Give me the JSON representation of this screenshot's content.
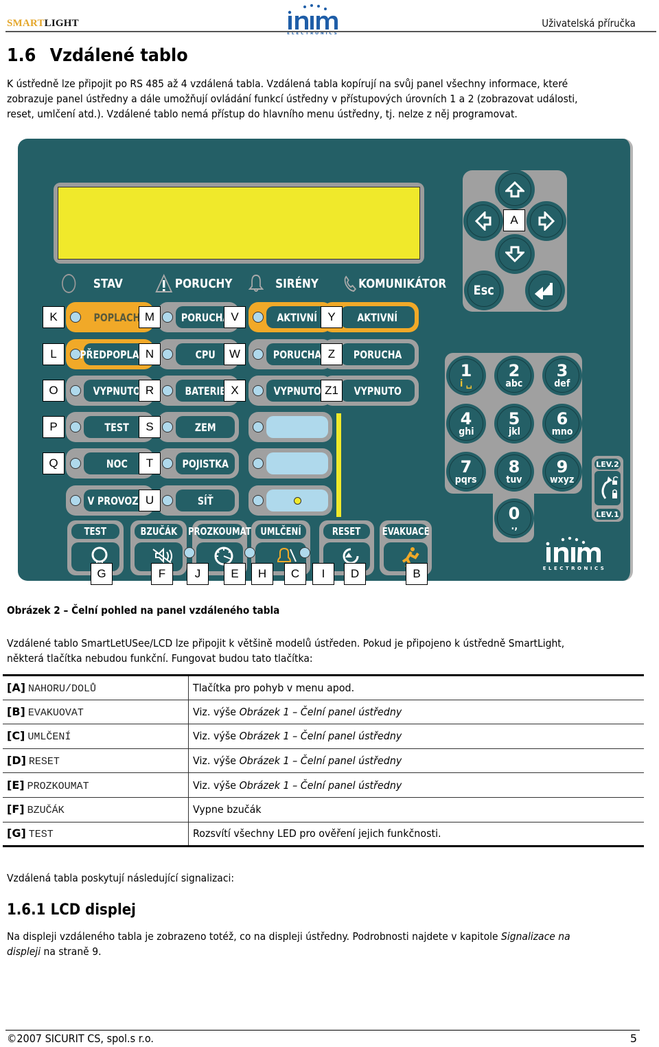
{
  "header": {
    "brand_part1": "SMART",
    "brand_part2": "LIGHT",
    "logo_text": "inim",
    "logo_sub": "ELECTRONICS",
    "doc_type": "Uživatelská příručka"
  },
  "section": {
    "number": "1.6",
    "title": "Vzdálené tablo",
    "intro_lines": [
      "K ústředně lze připojit po RS 485 až 4 vzdálená tabla. Vzdálená tabla kopírují na svůj panel všechny informace, které",
      "zobrazuje panel ústředny a dále umožňují ovládání funkcí ústředny v přístupových úrovních 1 a 2 (zobrazovat události,",
      "reset, umlčení atd.). Vzdálené tablo nemá přístup do hlavního menu ústředny, tj. nelze z něj programovat."
    ]
  },
  "panel": {
    "colors": {
      "body": "#245f66",
      "lcd": "#f0e92b",
      "frame": "#a0a0a0",
      "orange": "#f1a928",
      "led": "#afd9ec"
    },
    "status_labels": [
      "STAV",
      "PORUCHY",
      "SIRÉNY",
      "KOMUNIKÁTOR"
    ],
    "nav_label": "A",
    "esc_label": "Esc",
    "led_columns": [
      {
        "rows": [
          {
            "text": "POPLACH",
            "style": "orange-plain",
            "tag": "K"
          },
          {
            "text": "PŘEDPOPLACH",
            "style": "orange",
            "tag": "L"
          },
          {
            "text": "VYPNUTO",
            "style": "gray",
            "tag": "O"
          },
          {
            "text": "TEST",
            "style": "gray",
            "tag": "P"
          },
          {
            "text": "NOC",
            "style": "gray",
            "tag": "Q"
          },
          {
            "text": "V PROVOZU",
            "style": "gray",
            "tag": ""
          }
        ]
      },
      {
        "rows": [
          {
            "text": "PORUCHA",
            "style": "gray",
            "tag": "M"
          },
          {
            "text": "CPU",
            "style": "gray",
            "tag": "N"
          },
          {
            "text": "BATERIE",
            "style": "gray",
            "tag": "R"
          },
          {
            "text": "ZEM",
            "style": "gray",
            "tag": "S"
          },
          {
            "text": "POJISTKA",
            "style": "gray",
            "tag": "T"
          },
          {
            "text": "SÍŤ",
            "style": "gray",
            "tag": "U"
          }
        ]
      },
      {
        "rows": [
          {
            "text": "AKTIVNÍ",
            "style": "orange",
            "tag": "V"
          },
          {
            "text": "PORUCHA",
            "style": "gray",
            "tag": "W"
          },
          {
            "text": "VYPNUTO",
            "style": "gray",
            "tag": "X"
          },
          {
            "text": "",
            "style": "light",
            "tag": ""
          },
          {
            "text": "",
            "style": "light",
            "tag": ""
          },
          {
            "text": "",
            "style": "light-dot",
            "tag": ""
          }
        ]
      },
      {
        "rows": [
          {
            "text": "AKTIVNÍ",
            "style": "orange",
            "tag": "Y"
          },
          {
            "text": "PORUCHA",
            "style": "gray",
            "tag": "Z"
          },
          {
            "text": "VYPNUTO",
            "style": "gray",
            "tag": "Z1"
          }
        ]
      }
    ],
    "numpad": [
      {
        "digit": "1",
        "letters": "i ␣"
      },
      {
        "digit": "2",
        "letters": "abc"
      },
      {
        "digit": "3",
        "letters": "def"
      },
      {
        "digit": "4",
        "letters": "ghi"
      },
      {
        "digit": "5",
        "letters": "jkl"
      },
      {
        "digit": "6",
        "letters": "mno"
      },
      {
        "digit": "7",
        "letters": "pqrs"
      },
      {
        "digit": "8",
        "letters": "tuv"
      },
      {
        "digit": "9",
        "letters": "wxyz"
      },
      {
        "digit": "0",
        "letters": ".,"
      }
    ],
    "level_labels": [
      "LEV.2",
      "LEV.1"
    ],
    "function_keys": [
      "TEST",
      "BZUČÁK",
      "PROZKOUMAT",
      "UMLČENÍ",
      "RESET",
      "EVAKUACE"
    ],
    "function_tags": [
      "G",
      "F",
      "J",
      "E",
      "H",
      "C",
      "I",
      "D",
      "B"
    ],
    "brand_logo": "inim",
    "brand_sub": "ELECTRONICS"
  },
  "figure_caption": "Obrázek 2 – Čelní pohled na panel vzdáleného tabla",
  "compat_lines": [
    "Vzdálené tablo SmartLetUSee/LCD lze připojit k většině modelů ústředen. Pokud je připojeno k ústředně SmartLight,",
    "některá tlačítka nebudou funkční. Fungovat budou tato tlačítka:"
  ],
  "key_table": [
    {
      "key": "[A]",
      "name": "NAHORU/DOLŮ",
      "desc": "Tlačítka pro pohyb v menu apod.",
      "ref": ""
    },
    {
      "key": "[B]",
      "name": "EVAKUOVAT",
      "desc": "Viz. výše ",
      "ref": "Obrázek 1 – Čelní panel ústředny"
    },
    {
      "key": "[C]",
      "name": "UMLČENÍ",
      "desc": "Viz. výše ",
      "ref": "Obrázek 1 – Čelní panel ústředny"
    },
    {
      "key": "[D]",
      "name": "RESET",
      "desc": "Viz. výše ",
      "ref": "Obrázek 1 – Čelní panel ústředny"
    },
    {
      "key": "[E]",
      "name": "PROZKOUMAT",
      "desc": "Viz. výše ",
      "ref": "Obrázek 1 – Čelní panel ústředny"
    },
    {
      "key": "[F]",
      "name": "BZUČÁK",
      "desc": "Vypne bzučák",
      "ref": ""
    },
    {
      "key": "[G]",
      "name": "TEST",
      "desc": "Rozsvítí všechny LED pro ověření jejich funkčnosti.",
      "ref": ""
    }
  ],
  "signal_intro": "Vzdálená tabla poskytují následující signalizaci:",
  "subsection": {
    "number": "1.6.1",
    "title": "LCD displej",
    "text_line1": "Na displeji vzdáleného tabla je zobrazeno totéž, co na displeji ústředny. Podrobnosti najdete v kapitole ",
    "text_link1": "Signalizace na",
    "text_link2": "displeji",
    "text_line2_rest": " na straně 9."
  },
  "footer": {
    "copyright": "©2007 SICURIT CS, spol.s r.o.",
    "page": "5"
  }
}
